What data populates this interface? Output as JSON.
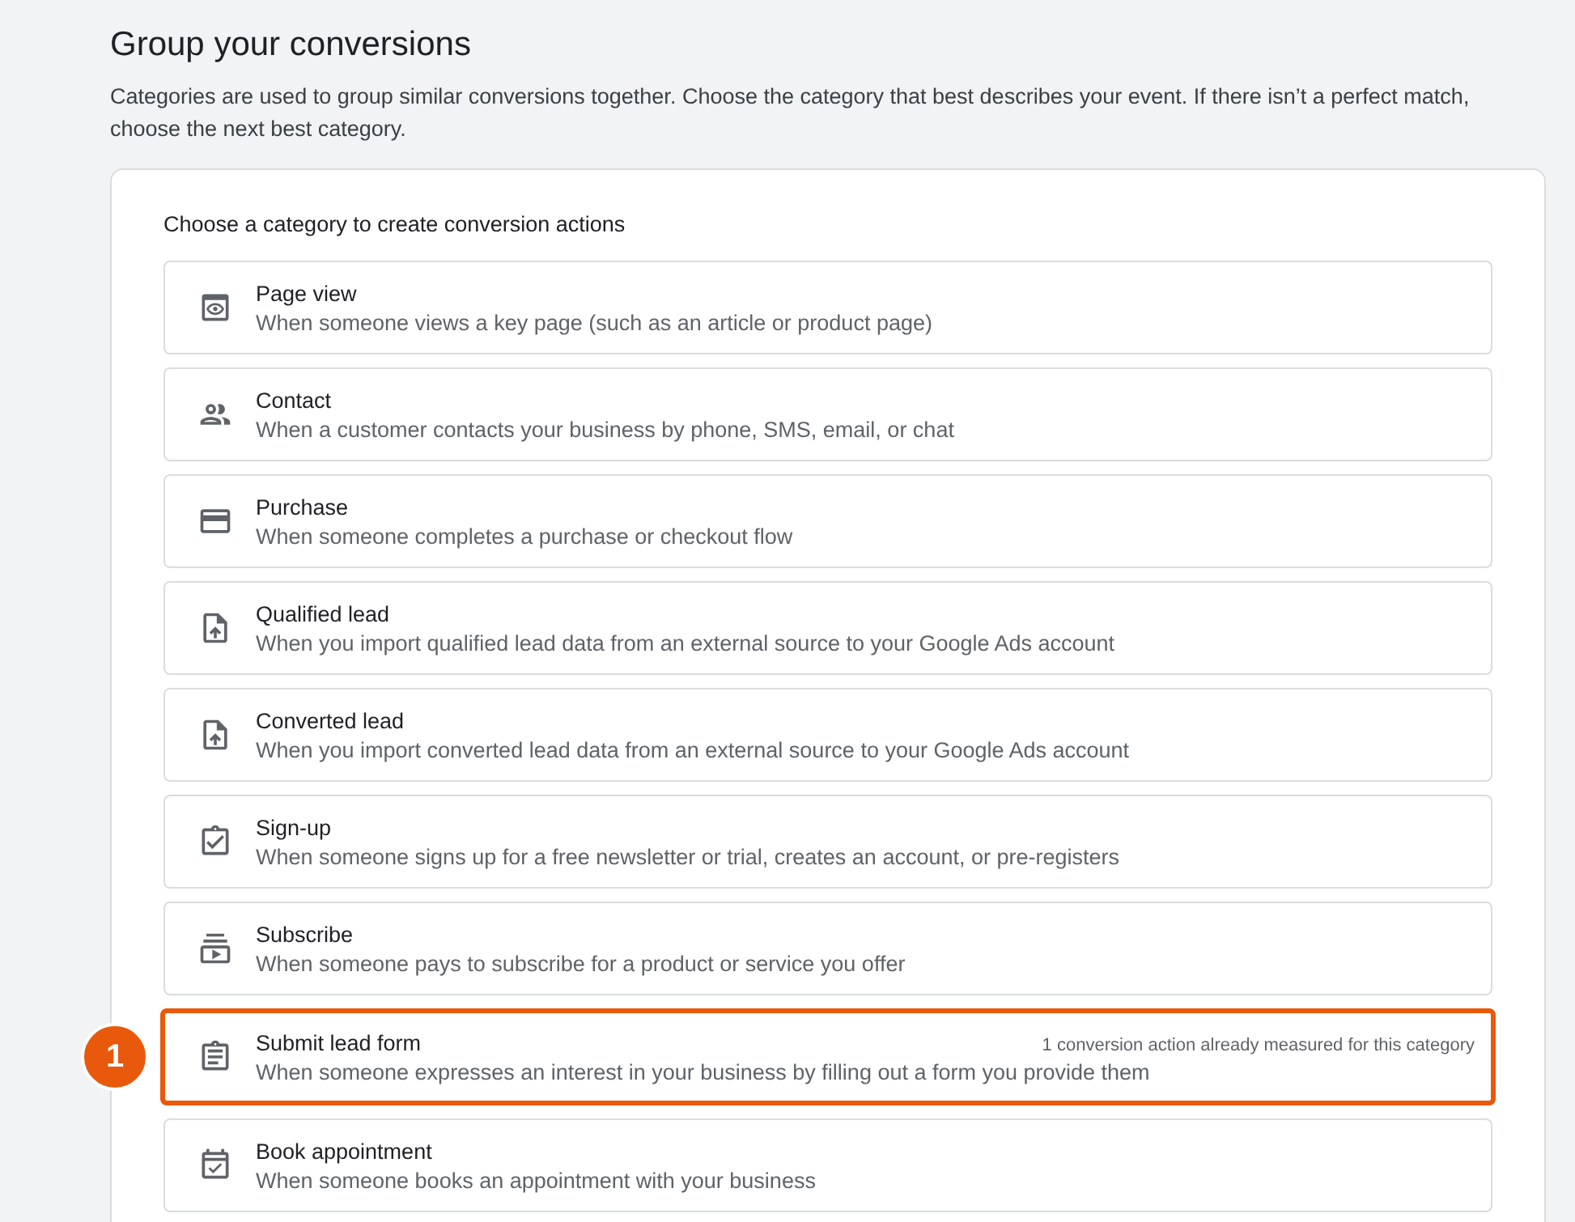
{
  "title": "Group your conversions",
  "description": "Categories are used to group similar conversions together. Choose the category that best describes your event. If there isn’t a perfect match, choose the next best category.",
  "card": {
    "heading": "Choose a category to create conversion actions",
    "categories": [
      {
        "kind": "page_view",
        "name": "Page view",
        "detail": "When someone views a key page (such as an article or product page)",
        "highlighted": false
      },
      {
        "kind": "contact",
        "name": "Contact",
        "detail": "When a customer contacts your business by phone, SMS, email, or chat",
        "highlighted": false
      },
      {
        "kind": "purchase",
        "name": "Purchase",
        "detail": "When someone completes a purchase or checkout flow",
        "highlighted": false
      },
      {
        "kind": "import",
        "name": "Qualified lead",
        "detail": "When you import qualified lead data from an external source to your Google Ads account",
        "highlighted": false
      },
      {
        "kind": "import",
        "name": "Converted lead",
        "detail": "When you import converted lead data from an external source to your Google Ads account",
        "highlighted": false
      },
      {
        "kind": "signup",
        "name": "Sign-up",
        "detail": "When someone signs up for a free newsletter or trial, creates an account, or pre-registers",
        "highlighted": false
      },
      {
        "kind": "subscribe",
        "name": "Subscribe",
        "detail": "When someone pays to subscribe for a product or service you offer",
        "highlighted": false
      },
      {
        "kind": "lead_form",
        "name": "Submit lead form",
        "detail": "When someone expresses an interest in your business by filling out a form you provide them",
        "note": "1 conversion action already measured for this category",
        "highlighted": true,
        "callout": "1"
      },
      {
        "kind": "appointment",
        "name": "Book appointment",
        "detail": "When someone books an appointment with your business",
        "highlighted": false
      }
    ]
  }
}
